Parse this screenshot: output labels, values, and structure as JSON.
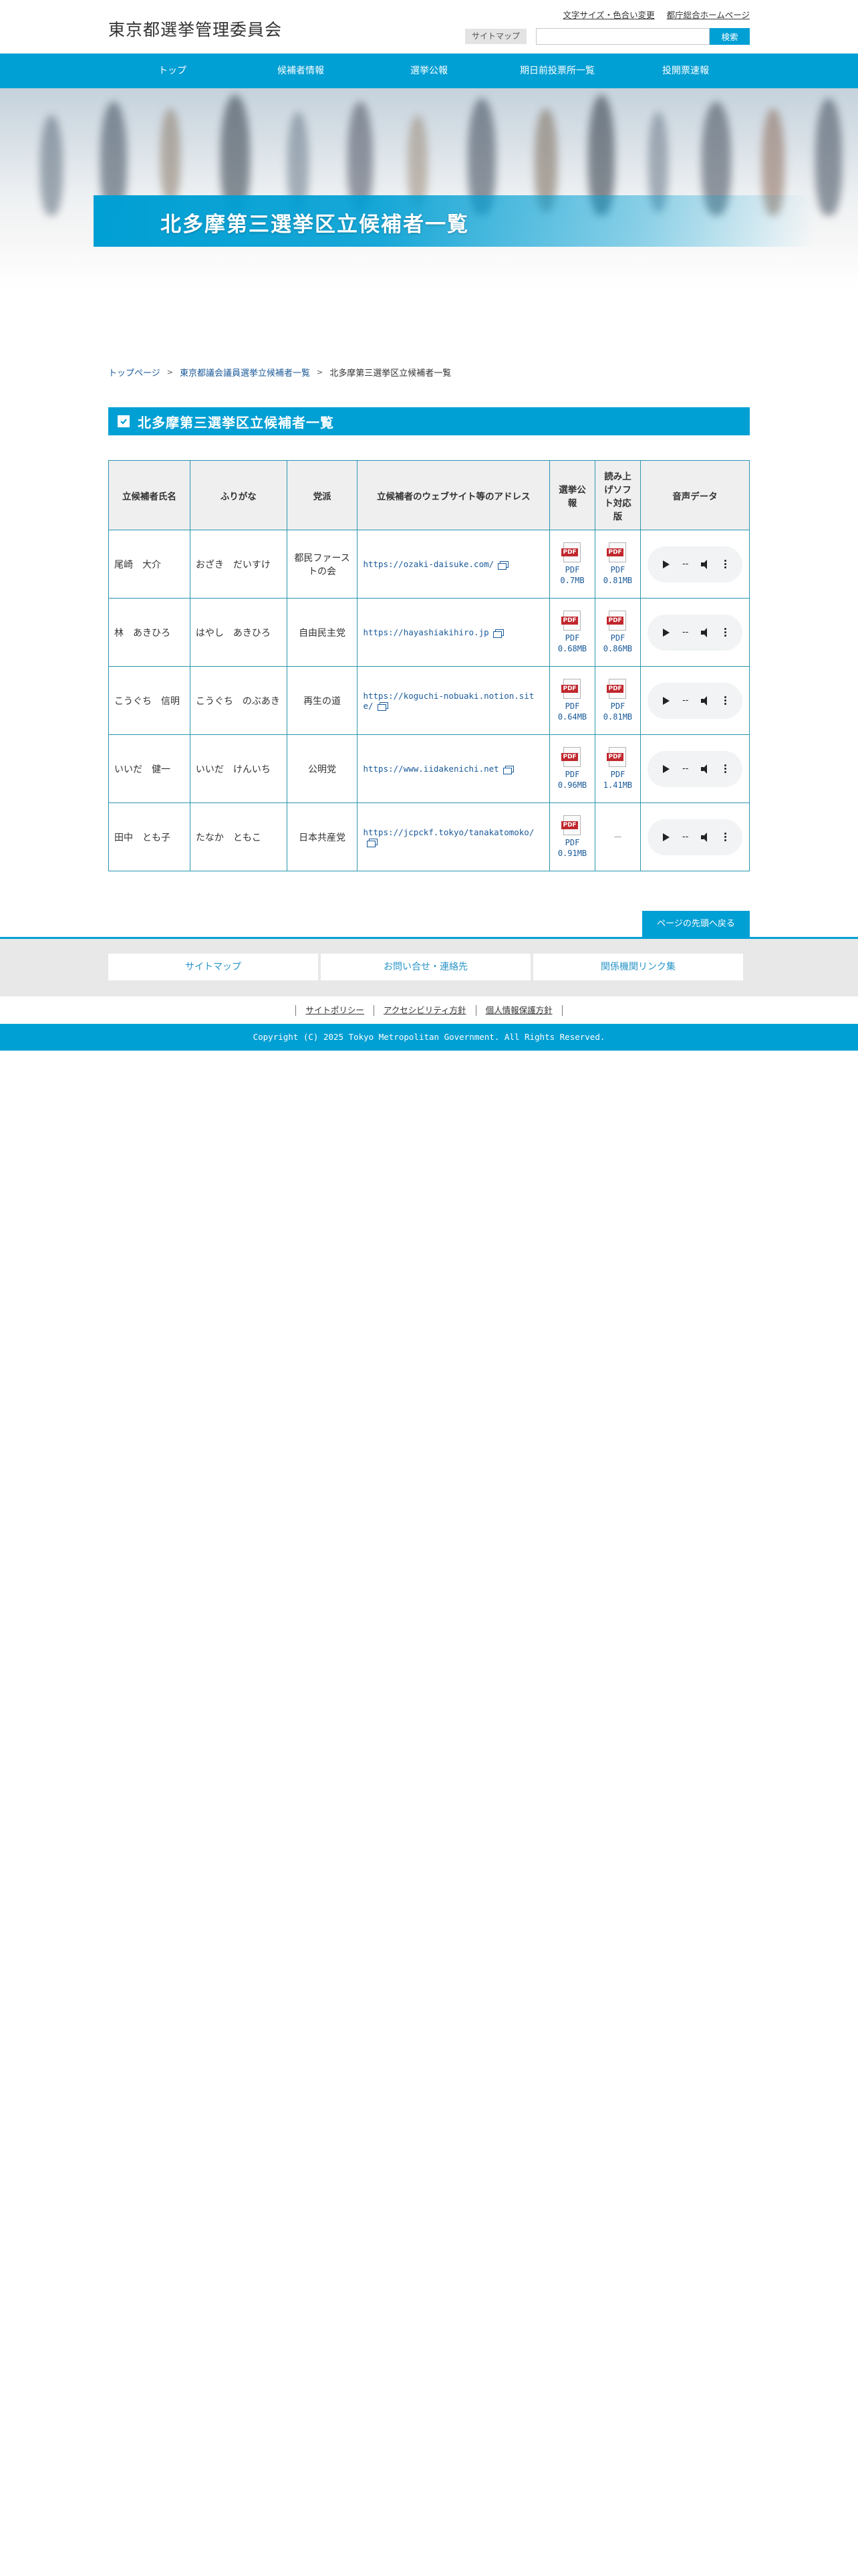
{
  "header": {
    "site_title": "東京都選挙管理委員会",
    "font_size_link": "文字サイズ・色合い変更",
    "metro_link": "都庁総合ホームページ",
    "sitemap_label": "サイトマップ",
    "search_placeholder": "",
    "search_button": "検索"
  },
  "nav": {
    "items": [
      {
        "label": "トップ"
      },
      {
        "label": "候補者情報"
      },
      {
        "label": "選挙公報"
      },
      {
        "label": "期日前投票所一覧"
      },
      {
        "label": "投開票速報"
      }
    ]
  },
  "hero": {
    "title": "北多摩第三選挙区立候補者一覧"
  },
  "breadcrumb": {
    "items": [
      {
        "label": "トップページ"
      },
      {
        "label": "東京都議会議員選挙立候補者一覧"
      },
      {
        "label": "北多摩第三選挙区立候補者一覧"
      }
    ],
    "separator": ">"
  },
  "section": {
    "title": "北多摩第三選挙区立候補者一覧"
  },
  "table": {
    "headers": {
      "name": "立候補者氏名",
      "furigana": "ふりがな",
      "party": "党派",
      "website": "立候補者のウェブサイト等のアドレス",
      "bulletin": "選挙公報",
      "reader": "読み上げソフト対応版",
      "audio": "音声データ"
    },
    "rows": [
      {
        "name": "尾崎　大介",
        "furigana": "おざき　だいすけ",
        "party": "都民ファーストの会",
        "url": "https://ozaki-daisuke.com/",
        "pdf1_label": "PDF",
        "pdf1_size": "0.7MB",
        "pdf2_label": "PDF",
        "pdf2_size": "0.81MB",
        "audio_time": "--"
      },
      {
        "name": "林　あきひろ",
        "furigana": "はやし　あきひろ",
        "party": "自由民主党",
        "url": "https://hayashiakihiro.jp",
        "pdf1_label": "PDF",
        "pdf1_size": "0.68MB",
        "pdf2_label": "PDF",
        "pdf2_size": "0.86MB",
        "audio_time": "--"
      },
      {
        "name": "こうぐち　信明",
        "furigana": "こうぐち　のぶあき",
        "party": "再生の道",
        "url": "https://koguchi-nobuaki.notion.site/",
        "pdf1_label": "PDF",
        "pdf1_size": "0.64MB",
        "pdf2_label": "PDF",
        "pdf2_size": "0.81MB",
        "audio_time": "--"
      },
      {
        "name": "いいだ　健一",
        "furigana": "いいだ　けんいち",
        "party": "公明党",
        "url": "https://www.iidakenichi.net",
        "pdf1_label": "PDF",
        "pdf1_size": "0.96MB",
        "pdf2_label": "PDF",
        "pdf2_size": "1.41MB",
        "audio_time": "--"
      },
      {
        "name": "田中　とも子",
        "furigana": "たなか　ともこ",
        "party": "日本共産党",
        "url": "https://jcpckf.tokyo/tanakatomoko/",
        "pdf1_label": "PDF",
        "pdf1_size": "0.91MB",
        "pdf2_label": "",
        "pdf2_size": "",
        "pdf2_none": "－",
        "audio_time": "--"
      }
    ]
  },
  "page_top": "ページの先頭へ戻る",
  "footer": {
    "links": [
      {
        "label": "サイトマップ"
      },
      {
        "label": "お問い合せ・連絡先"
      },
      {
        "label": "関係機関リンク集"
      }
    ],
    "policy": [
      {
        "label": "サイトポリシー"
      },
      {
        "label": "アクセシビリティ方針"
      },
      {
        "label": "個人情報保護方針"
      }
    ],
    "copyright": "Copyright (C) 2025 Tokyo Metropolitan Government. All Rights Reserved."
  },
  "colors": {
    "brand": "#009fd4",
    "link": "#1a5a9a",
    "table_border": "#2a95b0",
    "pdf_red": "#c0272d"
  },
  "icons": [
    "check-icon",
    "external-link-icon",
    "pdf-icon",
    "play-icon",
    "volume-icon",
    "more-icon"
  ]
}
